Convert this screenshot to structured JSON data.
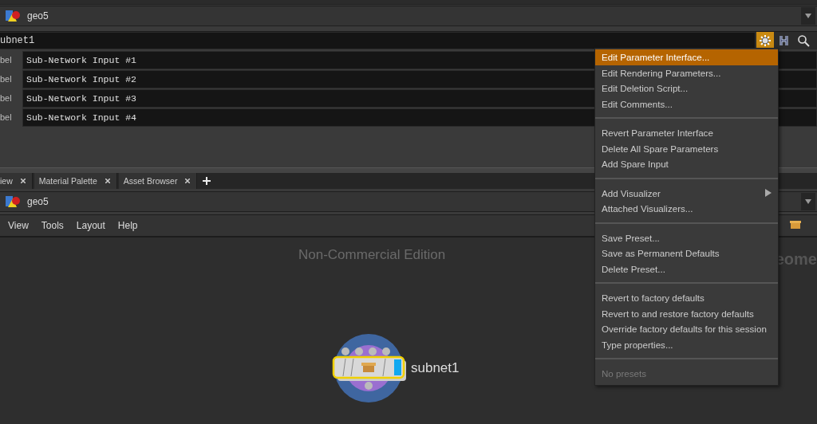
{
  "top_path": {
    "label": "geo5"
  },
  "node_name": {
    "value": "ubnet1"
  },
  "toolbar_icons": [
    {
      "kind": "gear",
      "selected": true
    },
    {
      "kind": "help",
      "selected": false
    },
    {
      "kind": "search",
      "selected": false
    }
  ],
  "parameters": [
    {
      "label": "bel",
      "value": "Sub-Network Input #1"
    },
    {
      "label": "bel",
      "value": "Sub-Network Input #2"
    },
    {
      "label": "bel",
      "value": "Sub-Network Input #3"
    },
    {
      "label": "bel",
      "value": "Sub-Network Input #4"
    }
  ],
  "pane_tabs": [
    {
      "label": "iew"
    },
    {
      "label": "Material Palette"
    },
    {
      "label": "Asset Browser"
    }
  ],
  "network_path": {
    "label": "geo5"
  },
  "menu_bar": [
    "View",
    "Tools",
    "Layout",
    "Help"
  ],
  "canvas": {
    "edition_text": "Non-Commercial Edition",
    "context_label": "eome"
  },
  "node": {
    "name": "subnet1",
    "selected": true
  },
  "context_menu": {
    "groups": [
      [
        {
          "label": "Edit Parameter Interface...",
          "selected": true
        },
        {
          "label": "Edit Rendering Parameters...",
          "selected": false
        },
        {
          "label": "Edit Deletion Script...",
          "selected": false
        },
        {
          "label": "Edit Comments...",
          "selected": false
        }
      ],
      [
        {
          "label": "Revert Parameter Interface",
          "selected": false
        },
        {
          "label": "Delete All Spare Parameters",
          "selected": false
        },
        {
          "label": "Add Spare Input",
          "selected": false
        }
      ],
      [
        {
          "label": "Add Visualizer",
          "selected": false,
          "submenu": true
        },
        {
          "label": "Attached Visualizers...",
          "selected": false
        }
      ],
      [
        {
          "label": "Save Preset...",
          "selected": false
        },
        {
          "label": "Save as Permanent Defaults",
          "selected": false
        },
        {
          "label": "Delete Preset...",
          "selected": false
        }
      ],
      [
        {
          "label": "Revert to factory defaults",
          "selected": false
        },
        {
          "label": "Revert to and restore factory defaults",
          "selected": false
        },
        {
          "label": "Override factory defaults for this session",
          "selected": false
        },
        {
          "label": "Type properties...",
          "selected": false
        }
      ],
      [
        {
          "label": "No presets",
          "selected": false,
          "disabled": true
        }
      ]
    ]
  }
}
